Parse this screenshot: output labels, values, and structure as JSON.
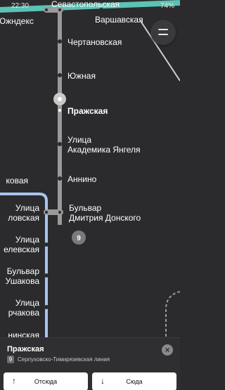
{
  "status_bar": {
    "time": "22:30",
    "battery": "74%"
  },
  "stations": [
    "Чертановская",
    "Южная",
    "Пражская",
    "Улица Академика Янгеля",
    "Аннино",
    "Бульвар Дмитрия Донского"
  ],
  "stations_wrapped": {
    "yangelya": [
      "Улица",
      "Академика Янгеля"
    ],
    "donskogo": [
      "Бульвар",
      "Дмитрия Донского"
    ]
  },
  "top_labels": {
    "left": "Южндекс",
    "top": "Севастопольская",
    "right": "Варшавская"
  },
  "left_labels": [
    "ковая",
    "Улица",
    "ловская",
    "Улица",
    "елевская",
    "Бульвар",
    "Ушакова",
    "Улица",
    "рчакова",
    "нинская"
  ],
  "line_badge_map": "9",
  "colors": {
    "line9": "#9a9a9a",
    "line_left": "#a9c4ef",
    "line_top": "#5bc2b5",
    "selected": "#ffffff"
  },
  "sheet": {
    "title": "Пражская",
    "line_number": "9",
    "line_name": "Серпуховско-Тимирязевская линия",
    "from_label": "Отсюда",
    "to_label": "Сюда"
  }
}
